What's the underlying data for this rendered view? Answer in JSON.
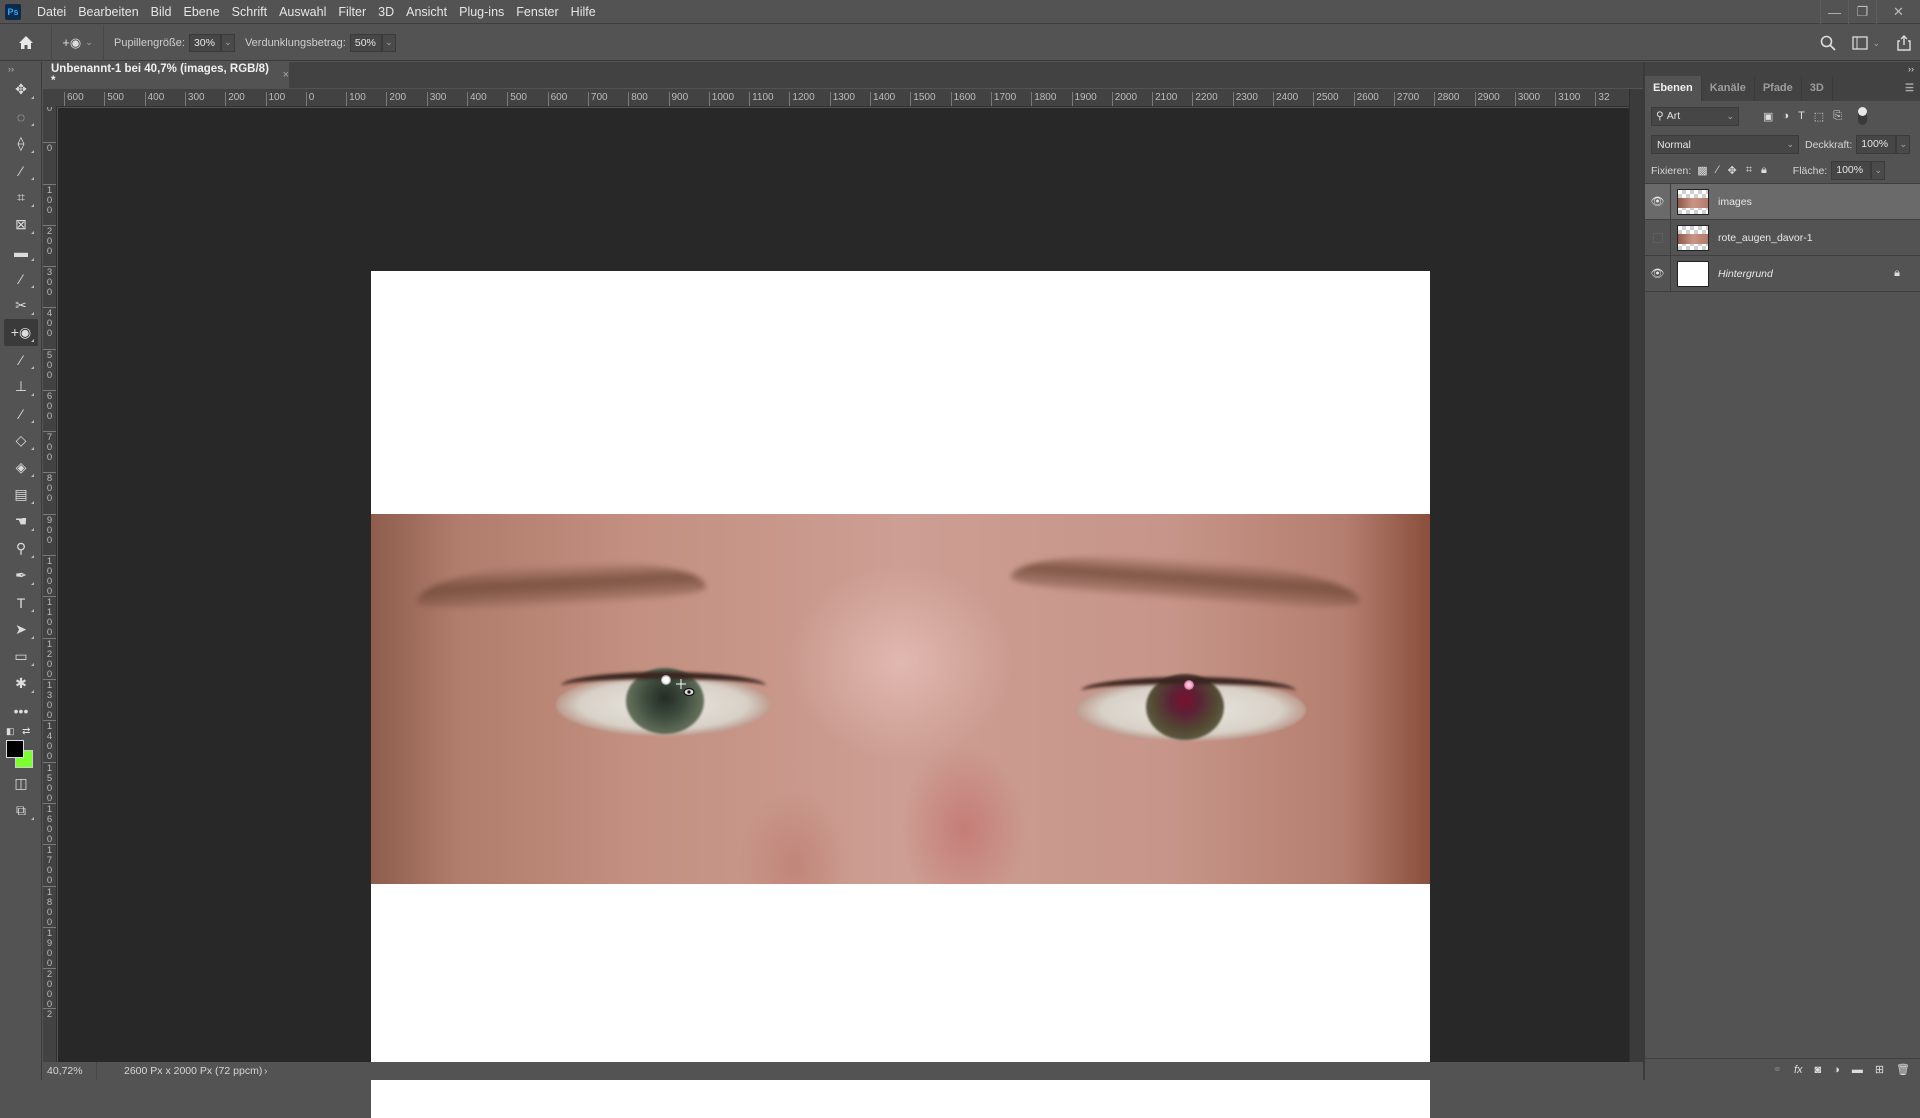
{
  "app": {
    "logo": "Ps",
    "menu": [
      "Datei",
      "Bearbeiten",
      "Bild",
      "Ebene",
      "Schrift",
      "Auswahl",
      "Filter",
      "3D",
      "Ansicht",
      "Plug-ins",
      "Fenster",
      "Hilfe"
    ],
    "window_controls": {
      "minimize": "—",
      "restore": "❐",
      "close": "✕"
    }
  },
  "options_bar": {
    "home_icon": "home-icon",
    "tool_icon": "red-eye-tool-icon",
    "pupil_size_label": "Pupillengröße:",
    "pupil_size_value": "30%",
    "darken_label": "Verdunklungsbetrag:",
    "darken_value": "50%",
    "right_icons": [
      "search-icon",
      "workspace-icon",
      "share-icon"
    ]
  },
  "document": {
    "tab_title": "Unbenannt-1 bei 40,7% (images, RGB/8) *",
    "close": "×"
  },
  "rulers": {
    "horizontal": [
      "600",
      "500",
      "400",
      "300",
      "200",
      "100",
      "0",
      "100",
      "200",
      "300",
      "400",
      "500",
      "600",
      "700",
      "800",
      "900",
      "1000",
      "1100",
      "1200",
      "1300",
      "1400",
      "1500",
      "1600",
      "1700",
      "1800",
      "1900",
      "2000",
      "2100",
      "2200",
      "2300",
      "2400",
      "2500",
      "2600",
      "2700",
      "2800",
      "2900",
      "3000",
      "3100",
      "32"
    ],
    "vertical": [
      "0",
      "100",
      "0",
      "100",
      "200",
      "300",
      "400",
      "500",
      "600",
      "700",
      "800",
      "900",
      "1000",
      "1100",
      "1200",
      "1300",
      "1400",
      "1500",
      "1600",
      "1700",
      "1800",
      "1900",
      "2000",
      "2"
    ]
  },
  "tools": [
    {
      "name": "move-tool",
      "glyph": "✥"
    },
    {
      "name": "lasso-ellipse-tool",
      "glyph": "◌"
    },
    {
      "name": "polygon-lasso-tool",
      "glyph": "⟠"
    },
    {
      "name": "magic-wand-tool",
      "glyph": "⁄"
    },
    {
      "name": "crop-tool",
      "glyph": "⌗"
    },
    {
      "name": "frame-tool",
      "glyph": "⊠"
    },
    {
      "name": "ruler-tool",
      "glyph": "▬"
    },
    {
      "name": "eyedropper-tool",
      "glyph": "⁄"
    },
    {
      "name": "healing-tool",
      "glyph": "✂"
    },
    {
      "name": "red-eye-tool",
      "glyph": "+◉"
    },
    {
      "name": "brush-tool",
      "glyph": "⁄"
    },
    {
      "name": "stamp-tool",
      "glyph": "⊥"
    },
    {
      "name": "history-brush-tool",
      "glyph": "⁄"
    },
    {
      "name": "eraser-tool",
      "glyph": "◇"
    },
    {
      "name": "paint-bucket-tool",
      "glyph": "◈"
    },
    {
      "name": "gradient-tool",
      "glyph": "▤"
    },
    {
      "name": "smudge-tool",
      "glyph": "☚"
    },
    {
      "name": "dodge-tool",
      "glyph": "⚲"
    },
    {
      "name": "pen-tool",
      "glyph": "✒"
    },
    {
      "name": "type-tool",
      "glyph": "T"
    },
    {
      "name": "path-select-tool",
      "glyph": "➤"
    },
    {
      "name": "rectangle-tool",
      "glyph": "▭"
    },
    {
      "name": "custom-shape-tool",
      "glyph": "✱"
    },
    {
      "name": "more-tools",
      "glyph": "•••"
    }
  ],
  "colors": {
    "foreground": "#000000",
    "background": "#7cff2e"
  },
  "status": {
    "zoom": "40,72%",
    "doc_info": "2600 Px x 2000 Px (72 ppcm)",
    "arrow": "›"
  },
  "panel": {
    "tabs": [
      "Ebenen",
      "Kanäle",
      "Pfade",
      "3D"
    ],
    "active_tab": "Ebenen",
    "filter_kind": "Art",
    "blend_mode": "Normal",
    "opacity_label": "Deckkraft:",
    "opacity_value": "100%",
    "lock_label": "Fixieren:",
    "fill_label": "Fläche:",
    "fill_value": "100%",
    "layers": [
      {
        "name": "images",
        "visible": true,
        "selected": true,
        "italic": false,
        "locked": false
      },
      {
        "name": "rote_augen_davor-1",
        "visible": false,
        "selected": false,
        "italic": false,
        "locked": false
      },
      {
        "name": "Hintergrund",
        "visible": true,
        "selected": false,
        "italic": true,
        "locked": true
      }
    ],
    "bottom_icons": [
      "link-icon",
      "fx-icon",
      "mask-icon",
      "adjustment-icon",
      "folder-icon",
      "new-layer-icon",
      "trash-icon"
    ]
  }
}
